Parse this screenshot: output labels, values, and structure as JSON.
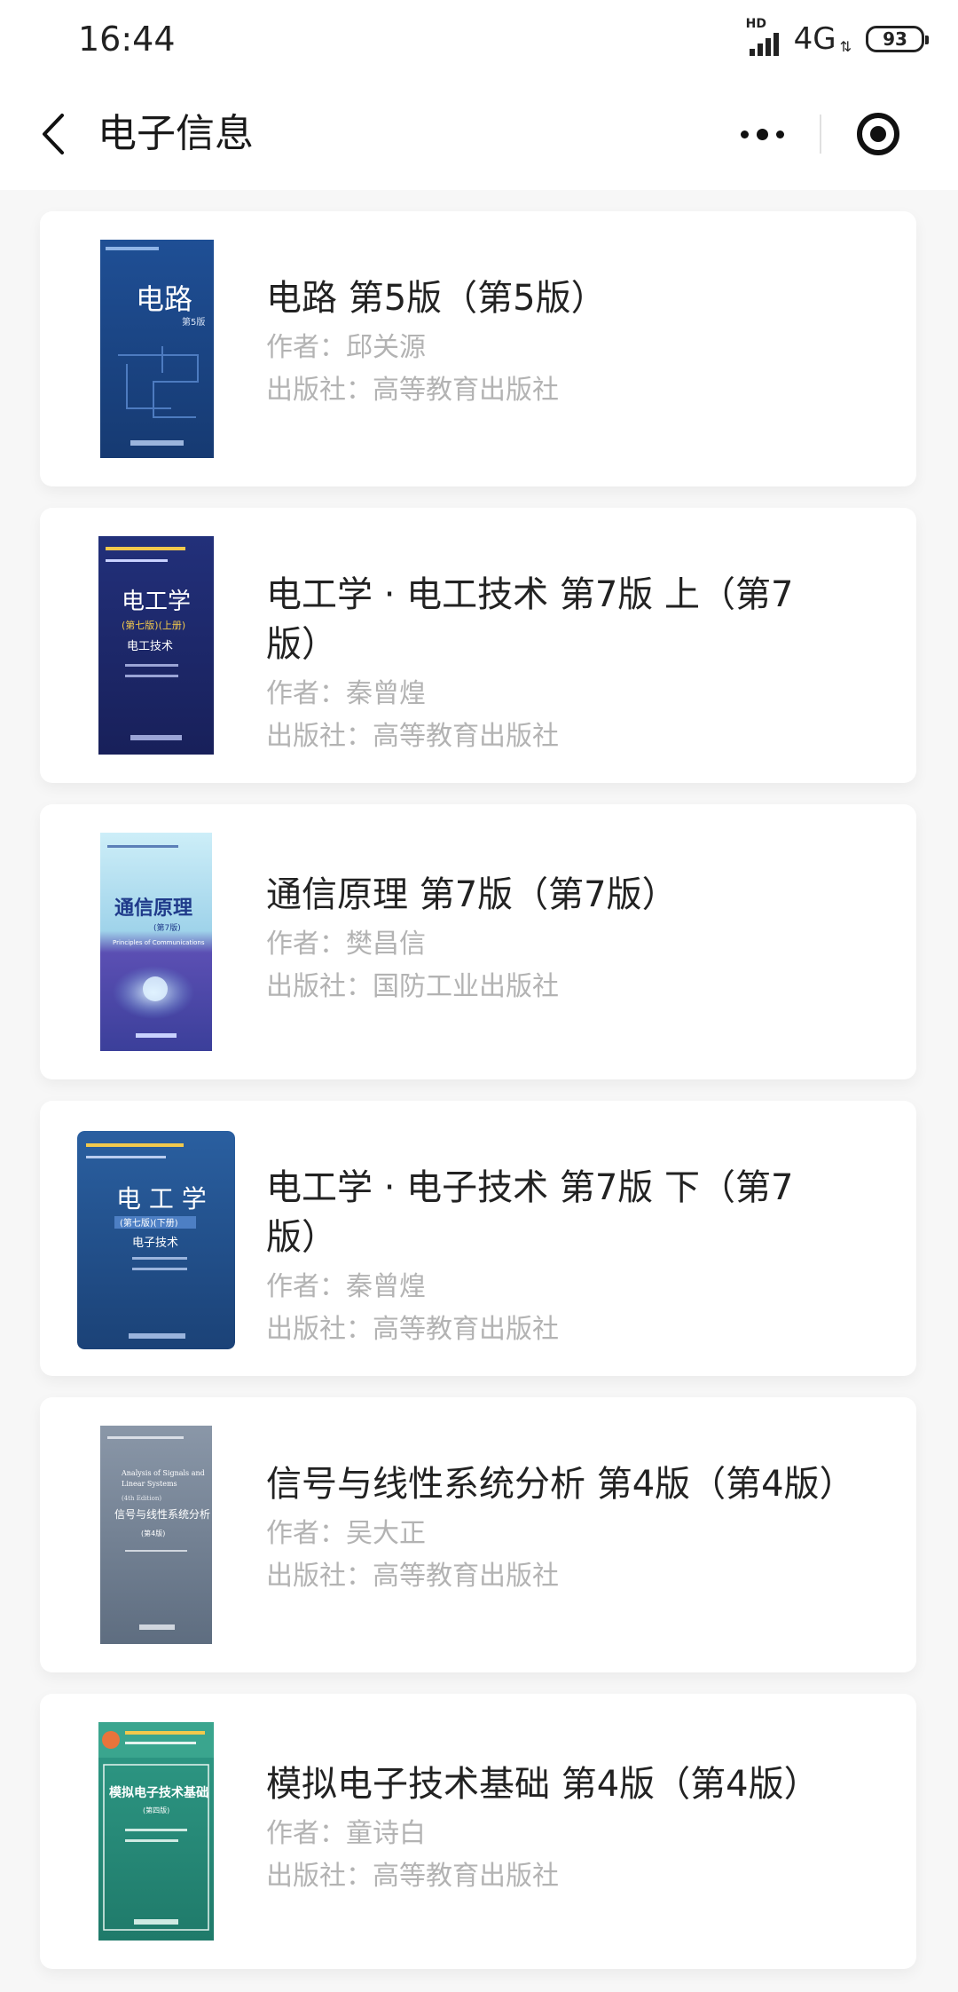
{
  "status_bar": {
    "time": "16:44",
    "hd": "HD",
    "network": "4G",
    "battery": "93"
  },
  "nav": {
    "title": "电子信息"
  },
  "books": [
    {
      "title": "电路 第5版（第5版）",
      "author": "作者：邱关源",
      "publisher": "出版社：高等教育出版社",
      "cover": {
        "colors": [
          "#1f4f95",
          "#163a72"
        ],
        "text": "电路",
        "sub": "第5版"
      }
    },
    {
      "title": "电工学 · 电工技术 第7版 上（第7版）",
      "author": "作者：秦曾煌",
      "publisher": "出版社：高等教育出版社",
      "cover": {
        "colors": [
          "#22307a",
          "#18205a"
        ],
        "text": "电工学",
        "sub": "电工技术"
      }
    },
    {
      "title": "通信原理 第7版（第7版）",
      "author": "作者：樊昌信",
      "publisher": "出版社：国防工业出版社",
      "cover": {
        "colors": [
          "#bfe6f5",
          "#3b3f9a"
        ],
        "text": "通信原理",
        "sub": "Principles of Communications"
      }
    },
    {
      "title": "电工学 · 电子技术 第7版 下（第7版）",
      "author": "作者：秦曾煌",
      "publisher": "出版社：高等教育出版社",
      "cover": {
        "colors": [
          "#2a5fa0",
          "#1b4277"
        ],
        "text": "电工学",
        "sub": "电子技术"
      }
    },
    {
      "title": "信号与线性系统分析 第4版（第4版）",
      "author": "作者：吴大正",
      "publisher": "出版社：高等教育出版社",
      "cover": {
        "colors": [
          "#7b8a9c",
          "#5e6d80"
        ],
        "text": "信号与线性系统分析",
        "sub": "Analysis of Signals and Linear Systems"
      }
    },
    {
      "title": "模拟电子技术基础 第4版（第4版）",
      "author": "作者：童诗白",
      "publisher": "出版社：高等教育出版社",
      "cover": {
        "colors": [
          "#2f9a86",
          "#1f7a6a"
        ],
        "text": "模拟电子技术基础",
        "sub": "第四版"
      }
    }
  ]
}
